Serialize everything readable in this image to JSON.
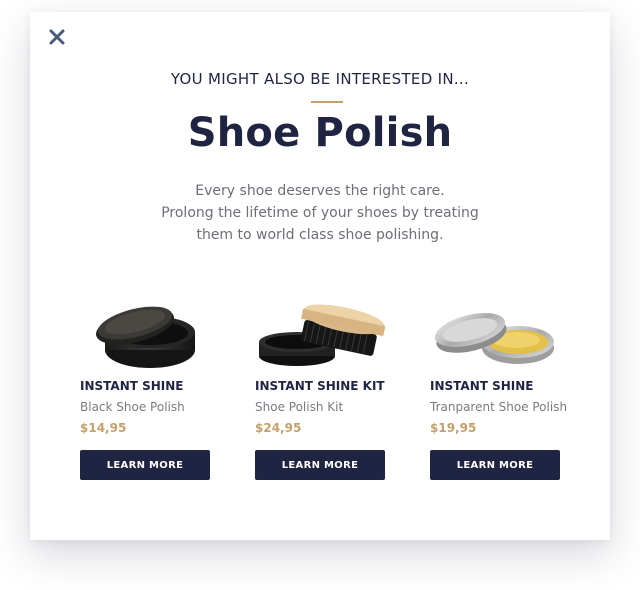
{
  "modal": {
    "close_icon": "close-icon",
    "eyebrow": "YOU MIGHT ALSO BE INTERESTED IN...",
    "title": "Shoe Polish",
    "description": [
      "Every shoe deserves the right care.",
      "Prolong the lifetime of your shoes by treating",
      "them to world class shoe polishing."
    ]
  },
  "colors": {
    "navy": "#1f2442",
    "gold": "#c4a06a",
    "muted_text": "#6d6f78"
  },
  "products": [
    {
      "image": "black-polish-tin",
      "name": "INSTANT SHINE",
      "subtitle": "Black Shoe Polish",
      "price": "$14,95",
      "button": "LEARN MORE"
    },
    {
      "image": "polish-kit-with-brush",
      "name": "INSTANT SHINE KIT",
      "subtitle": "Shoe Polish Kit",
      "price": "$24,95",
      "button": "LEARN MORE"
    },
    {
      "image": "transparent-polish-tin",
      "name": "INSTANT SHINE",
      "subtitle": "Tranparent Shoe Polish",
      "price": "$19,95",
      "button": "LEARN MORE"
    }
  ]
}
